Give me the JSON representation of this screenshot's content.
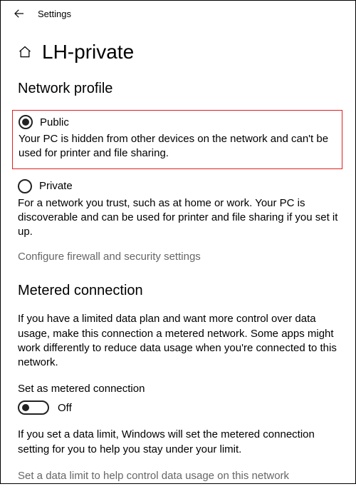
{
  "topbar": {
    "title": "Settings"
  },
  "page": {
    "title": "LH-private"
  },
  "network_profile": {
    "heading": "Network profile",
    "public": {
      "label": "Public",
      "description": "Your PC is hidden from other devices on the network and can't be used for printer and file sharing."
    },
    "private": {
      "label": "Private",
      "description": "For a network you trust, such as at home or work. Your PC is discoverable and can be used for printer and file sharing if you set it up."
    },
    "firewall_link": "Configure firewall and security settings"
  },
  "metered": {
    "heading": "Metered connection",
    "intro": "If you have a limited data plan and want more control over data usage, make this connection a metered network. Some apps might work differently to reduce data usage when you're connected to this network.",
    "toggle_label": "Set as metered connection",
    "toggle_state": "Off",
    "data_limit_note": "If you set a data limit, Windows will set the metered connection setting for you to help you stay under your limit.",
    "data_limit_link": "Set a data limit to help control data usage on this network"
  }
}
